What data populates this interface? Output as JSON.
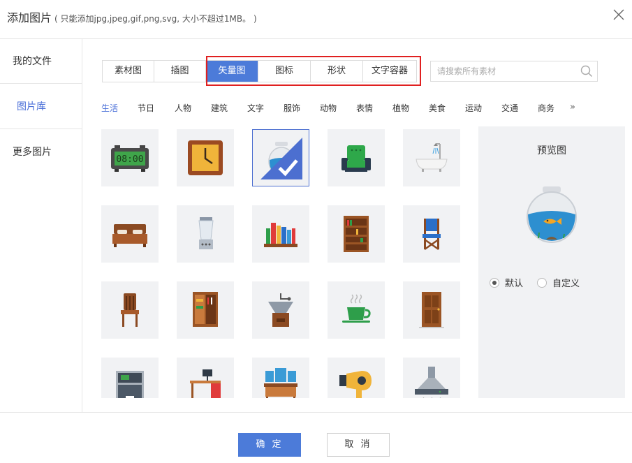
{
  "dialog": {
    "title": "添加图片",
    "subtitle": "( 只能添加jpg,jpeg,gif,png,svg, 大小不超过1MB。 )"
  },
  "sidebar": {
    "items": [
      {
        "label": "我的文件"
      },
      {
        "label": "图片库"
      },
      {
        "label": "更多图片"
      }
    ]
  },
  "tabs": [
    {
      "label": "素材图"
    },
    {
      "label": "插图"
    },
    {
      "label": "矢量图"
    },
    {
      "label": "图标"
    },
    {
      "label": "形状"
    },
    {
      "label": "文字容器"
    }
  ],
  "active_tab": "矢量图",
  "search": {
    "placeholder": "请搜索所有素材",
    "value": ""
  },
  "categories": [
    "生活",
    "节日",
    "人物",
    "建筑",
    "文字",
    "服饰",
    "动物",
    "表情",
    "植物",
    "美食",
    "运动",
    "交通",
    "商务"
  ],
  "active_category": "生活",
  "more_categories_glyph": "»",
  "items": [
    {
      "icon": "digital-clock-icon"
    },
    {
      "icon": "wall-clock-icon"
    },
    {
      "icon": "fishbowl-icon",
      "selected": true
    },
    {
      "icon": "armchair-icon"
    },
    {
      "icon": "bathtub-icon"
    },
    {
      "icon": "bed-icon"
    },
    {
      "icon": "blender-icon"
    },
    {
      "icon": "bookshelf-small-icon"
    },
    {
      "icon": "bookcase-icon"
    },
    {
      "icon": "blue-chair-icon"
    },
    {
      "icon": "wooden-chair-icon"
    },
    {
      "icon": "wardrobe-icon"
    },
    {
      "icon": "coffee-grinder-icon"
    },
    {
      "icon": "coffee-cup-icon"
    },
    {
      "icon": "door-icon"
    },
    {
      "icon": "coffee-machine-icon"
    },
    {
      "icon": "desk-icon"
    },
    {
      "icon": "dressing-table-icon"
    },
    {
      "icon": "hair-dryer-icon"
    },
    {
      "icon": "range-hood-icon"
    }
  ],
  "preview": {
    "title": "预览图",
    "icon": "fishbowl-icon",
    "options": [
      {
        "label": "默认",
        "checked": true
      },
      {
        "label": "自定义",
        "checked": false
      }
    ]
  },
  "footer": {
    "ok_label": "确 定",
    "cancel_label": "取 消"
  },
  "colors": {
    "accent": "#4c7bd9",
    "highlight_border": "#e02020",
    "tile_bg": "#f1f2f4",
    "active_text": "#4a6fd8"
  }
}
